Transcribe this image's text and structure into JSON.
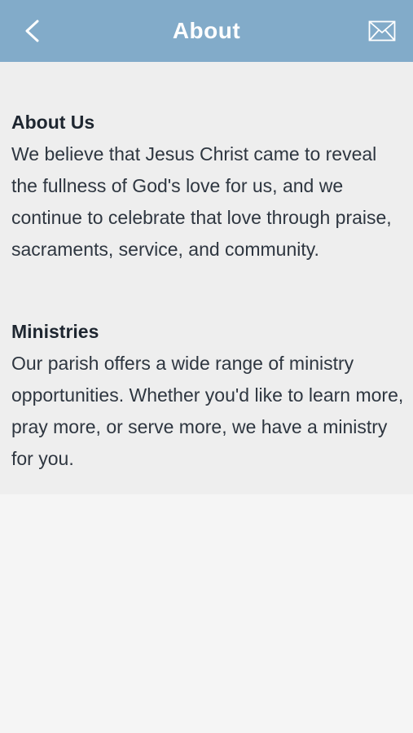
{
  "header": {
    "title": "About",
    "back_icon": "chevron-left-icon",
    "mail_icon": "envelope-icon",
    "background_color": "#82abc9"
  },
  "sections": [
    {
      "title": "About Us",
      "body": "We believe that Jesus Christ came to reveal the fullness of God's love for us, and we continue to celebrate that love through praise, sacraments, service, and community."
    },
    {
      "title": "Ministries",
      "body": "Our parish offers a wide range of ministry opportunities. Whether you'd like to learn more, pray more, or serve more, we have a ministry for you."
    }
  ]
}
